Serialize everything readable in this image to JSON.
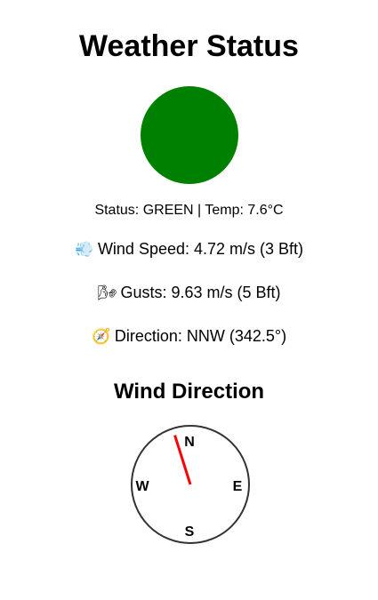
{
  "page": {
    "title": "Weather Status"
  },
  "status": {
    "color": "#008000",
    "text": "Status: GREEN | Temp: 7.6°C"
  },
  "metrics": {
    "wind_speed": {
      "icon": "dashing-wind-icon",
      "emoji": "💨",
      "text": "Wind Speed: 4.72 m/s (3 Bft)"
    },
    "gusts": {
      "icon": "wind-face-icon",
      "emoji": "🌬",
      "text": "Gusts: 9.63 m/s (5 Bft)"
    },
    "direction": {
      "icon": "compass-icon",
      "emoji": "🧭",
      "text": "Direction: NNW (342.5°)"
    }
  },
  "compass": {
    "title": "Wind Direction",
    "direction_degrees": 342.5,
    "needle_color": "#ff0000",
    "labels": {
      "north": "N",
      "east": "E",
      "south": "S",
      "west": "W"
    }
  }
}
